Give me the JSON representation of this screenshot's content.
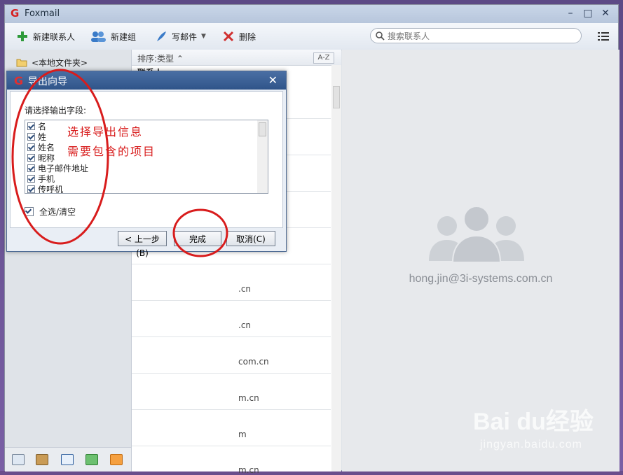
{
  "app": {
    "title": "Foxmail",
    "logo": "G"
  },
  "toolbar": {
    "new_contact": "新建联系人",
    "new_group": "新建组",
    "write_mail": "写邮件",
    "delete": "删除",
    "search_placeholder": "搜索联系人"
  },
  "sidebar": {
    "folder": "<本地文件夹>"
  },
  "list": {
    "sort_label": "排序:类型",
    "az_label": "A-Z",
    "group_head": "联系人",
    "entries": [
      ".cn",
      ".cn",
      "com.cn",
      "m.cn",
      "m",
      "m.cn"
    ]
  },
  "detail": {
    "email": "hong.jin@3i-systems.com.cn"
  },
  "dialog": {
    "title": "导出向导",
    "prompt": "请选择输出字段:",
    "fields": [
      "名",
      "姓",
      "姓名",
      "昵称",
      "电子邮件地址",
      "手机",
      "传呼机"
    ],
    "select_all": "全选/清空",
    "prev": "< 上一步(B)",
    "finish": "完成",
    "cancel": "取消(C)"
  },
  "annotation": {
    "line1": "选择导出信息",
    "line2": "需要包含的项目"
  },
  "watermark": {
    "brand": "Bai du经验",
    "sub": "jingyan.baidu.com"
  },
  "colors": {
    "accent": "#2f5489",
    "annotation": "#d81c1c"
  }
}
